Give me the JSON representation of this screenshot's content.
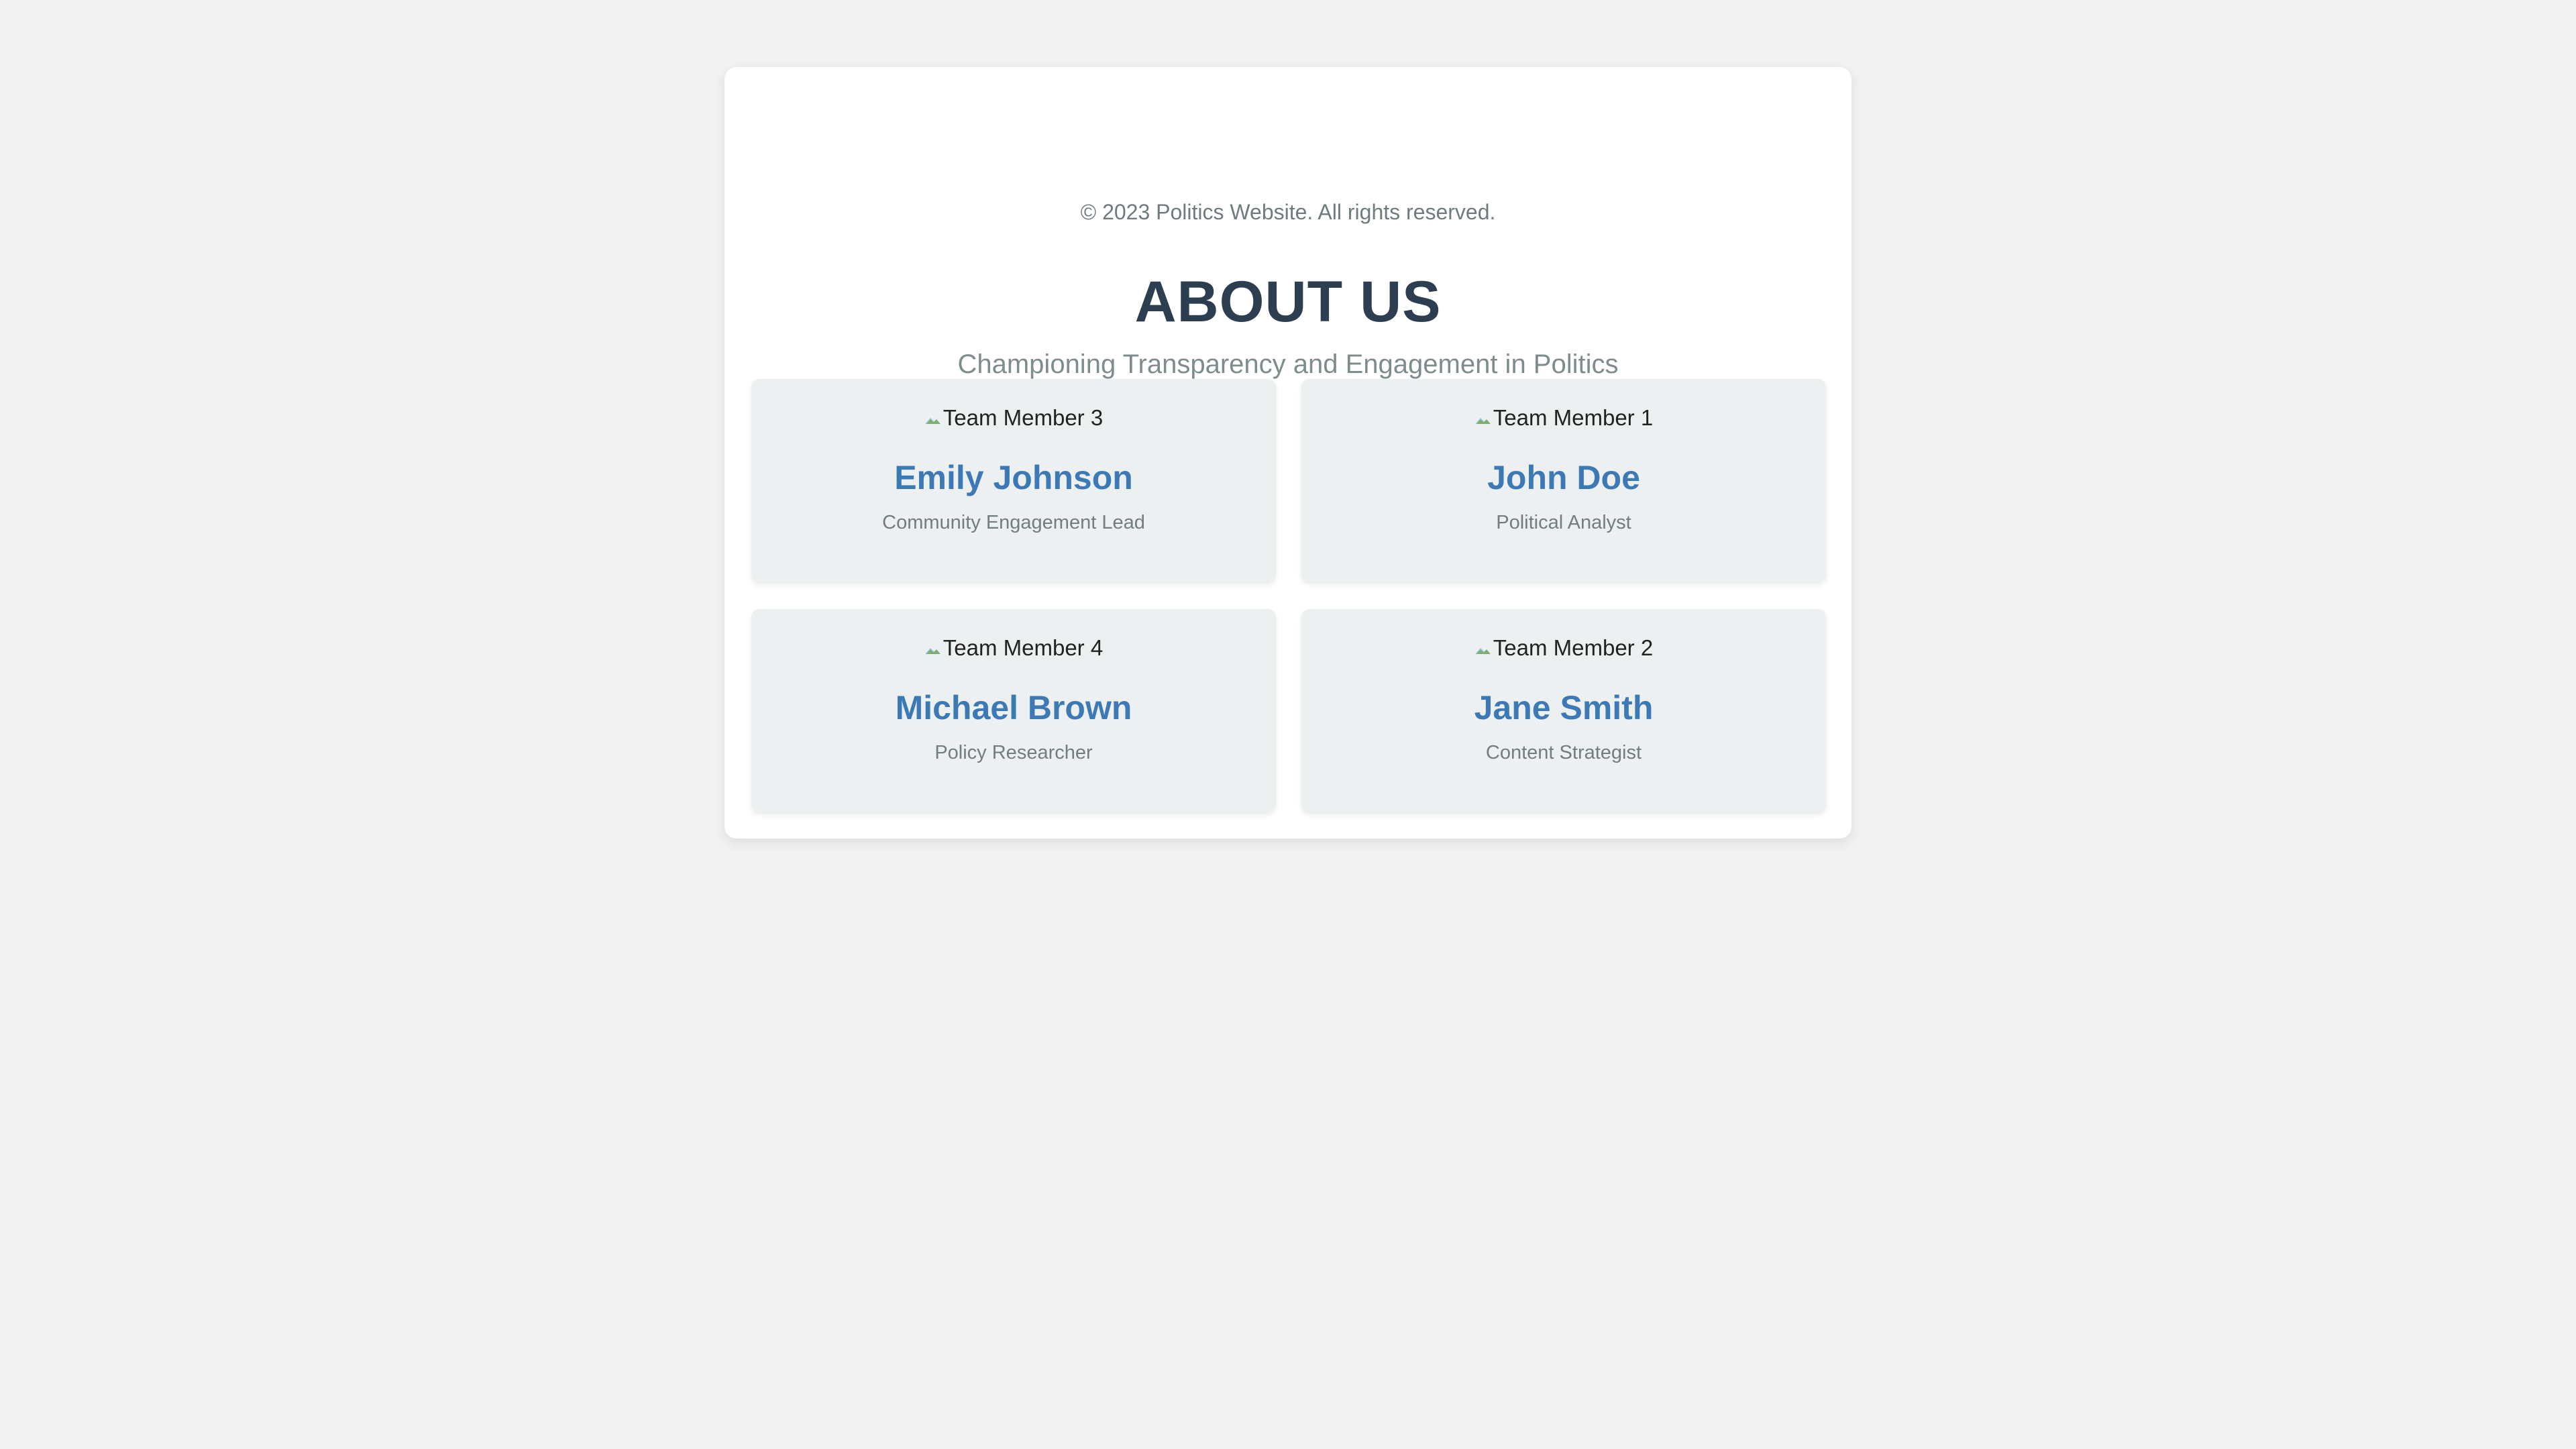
{
  "footer": {
    "copyright": "© 2023 Politics Website. All rights reserved."
  },
  "header": {
    "title": "ABOUT US",
    "subtitle": "Championing Transparency and Engagement in Politics"
  },
  "team": [
    {
      "image_alt": "Team Member 3",
      "name": "Emily Johnson",
      "role": "Community Engagement Lead"
    },
    {
      "image_alt": "Team Member 1",
      "name": "John Doe",
      "role": "Political Analyst"
    },
    {
      "image_alt": "Team Member 4",
      "name": "Michael Brown",
      "role": "Policy Researcher"
    },
    {
      "image_alt": "Team Member 2",
      "name": "Jane Smith",
      "role": "Content Strategist"
    }
  ],
  "colors": {
    "background": "#f3f3f3",
    "panel": "#ffffff",
    "card": "#ecf0f1",
    "title": "#2c3e50",
    "name_accent": "#3d7ab5",
    "muted_text": "#7f8c8d"
  },
  "icons": {
    "broken_image": "broken-image-icon"
  }
}
